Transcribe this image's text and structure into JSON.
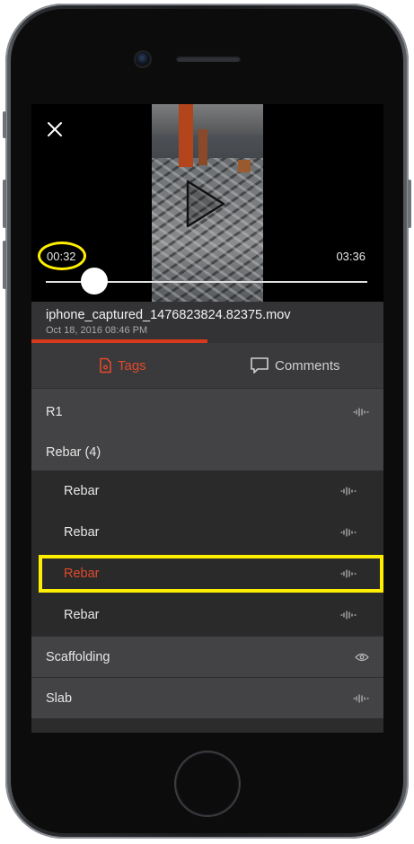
{
  "video": {
    "current_time": "00:32",
    "duration": "03:36",
    "position_fraction": 0.15
  },
  "file": {
    "name": "iphone_captured_1476823824.82375.mov",
    "date": "Oct 18, 2016 08:46 PM",
    "progress_fraction": 0.5
  },
  "tabs": {
    "tags_label": "Tags",
    "comments_label": "Comments",
    "active": "Tags"
  },
  "tags": {
    "r1": {
      "label": "R1",
      "icon": "audio-waveform-icon"
    },
    "rebar_group": {
      "label": "Rebar (4)",
      "expanded": true
    },
    "rebar_items": [
      {
        "label": "Rebar",
        "icon": "audio-waveform-icon"
      },
      {
        "label": "Rebar",
        "icon": "audio-waveform-icon"
      },
      {
        "label": "Rebar",
        "icon": "audio-waveform-icon",
        "selected": true
      },
      {
        "label": "Rebar",
        "icon": "audio-waveform-icon"
      }
    ],
    "scaffolding": {
      "label": "Scaffolding",
      "icon": "eye-icon"
    },
    "slab": {
      "label": "Slab",
      "icon": "audio-waveform-icon"
    }
  },
  "colors": {
    "accent": "#d9391c",
    "highlight": "#ffee00",
    "background": "#2c2c2d"
  }
}
